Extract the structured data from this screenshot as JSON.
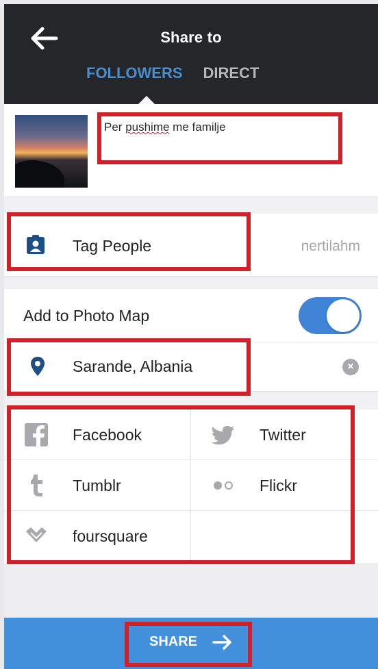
{
  "header": {
    "title": "Share to",
    "tabs": [
      {
        "label": "FOLLOWERS",
        "active": true
      },
      {
        "label": "DIRECT",
        "active": false
      }
    ]
  },
  "caption": {
    "text_part1": "Per ",
    "text_misspelled": "pushime",
    "text_part2": " me familje"
  },
  "tag_people": {
    "label": "Tag People",
    "tagged_user": "nertilahm"
  },
  "photo_map": {
    "label": "Add to Photo Map",
    "enabled": true,
    "location": "Sarande, Albania"
  },
  "share_services": [
    {
      "label": "Facebook",
      "icon": "facebook-icon"
    },
    {
      "label": "Twitter",
      "icon": "twitter-icon"
    },
    {
      "label": "Tumblr",
      "icon": "tumblr-icon"
    },
    {
      "label": "Flickr",
      "icon": "flickr-icon"
    },
    {
      "label": "foursquare",
      "icon": "foursquare-icon"
    }
  ],
  "share_button": {
    "label": "SHARE"
  },
  "colors": {
    "header_bg": "#24262a",
    "accent_blue": "#4a8dcc",
    "toggle_on": "#3f84d6",
    "share_bar": "#4390dc",
    "annotation_red": "#d0202a",
    "icon_gray": "#a9a9ad"
  }
}
